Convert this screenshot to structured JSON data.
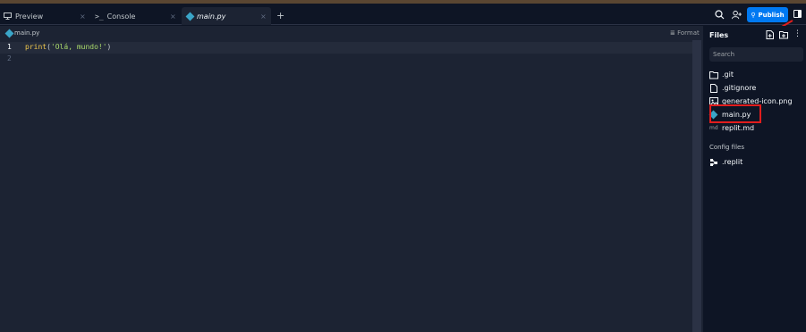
{
  "tabs": [
    {
      "label": "Preview",
      "icon": "monitor-icon"
    },
    {
      "label": "Console",
      "icon": "terminal-icon"
    },
    {
      "label": "main.py",
      "icon": "python-icon",
      "active": true
    }
  ],
  "header": {
    "publish_label": "Publish",
    "publish_color": "#0079f2"
  },
  "editor": {
    "breadcrumb": "main.py",
    "format_label": "Format",
    "lines": [
      {
        "number": "1",
        "fn": "print",
        "open": "(",
        "str": "'Olá, mundo!'",
        "close": ")"
      },
      {
        "number": "2"
      }
    ]
  },
  "files": {
    "title": "Files",
    "search_placeholder": "Search",
    "items": [
      {
        "name": ".git",
        "icon": "folder-icon"
      },
      {
        "name": ".gitignore",
        "icon": "file-icon"
      },
      {
        "name": "generated-icon.png",
        "icon": "image-icon"
      },
      {
        "name": "main.py",
        "icon": "python-icon"
      },
      {
        "name": "replit.md",
        "icon": "markdown-icon"
      }
    ],
    "config_title": "Config files",
    "config_items": [
      {
        "name": ".replit",
        "icon": "config-icon"
      }
    ]
  },
  "colors": {
    "background": "#0e1525",
    "editor_bg": "#1c2333",
    "highlight": "#e11d1d"
  }
}
